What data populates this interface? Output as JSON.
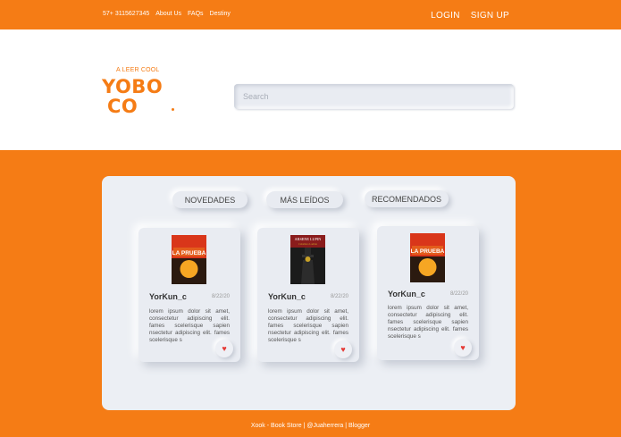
{
  "topbar": {
    "links": [
      "57+ 3115627345",
      "About Us",
      "FAQs",
      "Destiny"
    ],
    "login": "LOGIN",
    "signup": "SIGN UP"
  },
  "logo": {
    "tagline": "A LEER COOL",
    "line1": "YOBO",
    "line2": "CO"
  },
  "search": {
    "placeholder": "Search"
  },
  "tabs": [
    "NOVEDADES",
    "MÁS LEÍDOS",
    "RECOMENDADOS"
  ],
  "cards": [
    {
      "cover": {
        "title": "LA PRUEBA",
        "subtitle": "",
        "palette": [
          "#2b1a10",
          "#d9361a",
          "#f6a623"
        ]
      },
      "user": "YorKun_c",
      "date": "8/22/20",
      "text": "lorem ipsum dolor sit amet, consectetur adipiscing elit. fames scelerisque sapien nsectetur adipiscing elit. fames scelerisque s",
      "like_icon": "heart-icon"
    },
    {
      "cover": {
        "title": "ARSENE LUPIN",
        "subtitle": "Caballero Ladrón",
        "palette": [
          "#1b1b1b",
          "#8a1c1c",
          "#c9a227"
        ]
      },
      "user": "YorKun_c",
      "date": "8/22/20",
      "text": "lorem ipsum dolor sit amet, consectetur adipiscing elit. fames scelerisque sapien nsectetur adipiscing elit. fames scelerisque s",
      "like_icon": "heart-icon"
    },
    {
      "cover": {
        "title": "LA PRUEBA",
        "subtitle": "",
        "palette": [
          "#2b1a10",
          "#d9361a",
          "#f6a623"
        ]
      },
      "user": "YorKun_c",
      "date": "8/22/20",
      "text": "lorem ipsum dolor sit amet, consectetur adipiscing elit. fames scelerisque sapien nsectetur adipiscing elit. fames scelerisque s",
      "like_icon": "heart-icon"
    }
  ],
  "footer": "Xook - Book Store | @Juaherrera | Blogger",
  "colors": {
    "accent": "#f57c15",
    "panel": "#eceff4",
    "heart": "#e53935"
  }
}
